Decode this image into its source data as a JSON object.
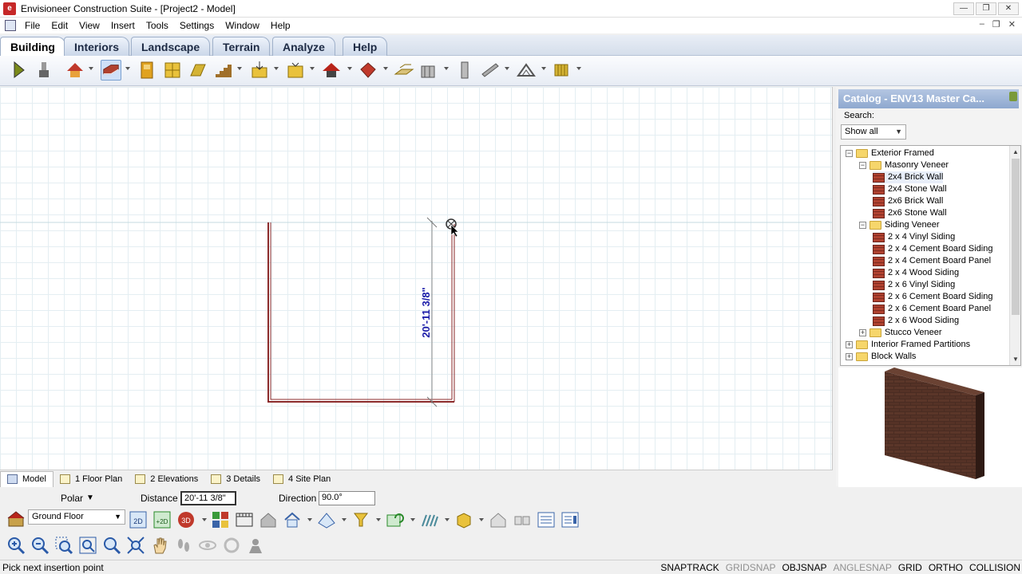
{
  "window": {
    "title": "Envisioneer Construction Suite - [Project2 - Model]",
    "app_icon_letter": "e"
  },
  "menu": [
    "File",
    "Edit",
    "View",
    "Insert",
    "Tools",
    "Settings",
    "Window",
    "Help"
  ],
  "ribbon_tabs": [
    "Building",
    "Interiors",
    "Landscape",
    "Terrain",
    "Analyze",
    "Help"
  ],
  "active_tab": "Building",
  "canvas": {
    "dimension_label": "20'-11 3/8\"",
    "wall_color": "#8b2a2a",
    "dimension_color": "#1a1aa8",
    "grid_color": "#e4eef2"
  },
  "catalog": {
    "header": "Catalog - ENV13 Master Ca...",
    "search_label": "Search:",
    "search_value": "Show all",
    "tree": [
      {
        "label": "Exterior Framed",
        "level": 0,
        "type": "folder",
        "exp": "-"
      },
      {
        "label": "Masonry Veneer",
        "level": 1,
        "type": "folder",
        "exp": "-"
      },
      {
        "label": "2x4  Brick Wall",
        "level": 2,
        "type": "wall",
        "selected": true
      },
      {
        "label": "2x4 Stone Wall",
        "level": 2,
        "type": "wall"
      },
      {
        "label": "2x6 Brick Wall",
        "level": 2,
        "type": "wall"
      },
      {
        "label": "2x6 Stone Wall",
        "level": 2,
        "type": "wall"
      },
      {
        "label": "Siding Veneer",
        "level": 1,
        "type": "folder",
        "exp": "-"
      },
      {
        "label": "2 x 4 Vinyl Siding",
        "level": 2,
        "type": "wall"
      },
      {
        "label": "2 x 4 Cement Board Siding",
        "level": 2,
        "type": "wall"
      },
      {
        "label": "2 x 4 Cement Board Panel",
        "level": 2,
        "type": "wall"
      },
      {
        "label": "2 x 4 Wood Siding",
        "level": 2,
        "type": "wall"
      },
      {
        "label": "2 x 6 Vinyl Siding",
        "level": 2,
        "type": "wall"
      },
      {
        "label": "2 x 6 Cement Board Siding",
        "level": 2,
        "type": "wall"
      },
      {
        "label": "2 x 6 Cement Board Panel",
        "level": 2,
        "type": "wall"
      },
      {
        "label": "2 x 6 Wood Siding",
        "level": 2,
        "type": "wall"
      },
      {
        "label": "Stucco Veneer",
        "level": 1,
        "type": "folder",
        "exp": "+"
      },
      {
        "label": "Interior Framed Partitions",
        "level": 0,
        "type": "folder",
        "exp": "+"
      },
      {
        "label": "Block Walls",
        "level": 0,
        "type": "folder",
        "exp": "+"
      }
    ]
  },
  "sheet_tabs": [
    {
      "label": "Model",
      "active": true
    },
    {
      "label": "1 Floor Plan"
    },
    {
      "label": "2 Elevations"
    },
    {
      "label": "3 Details"
    },
    {
      "label": "4 Site Plan"
    }
  ],
  "command": {
    "mode": "Polar",
    "distance_label": "Distance",
    "distance_value": "20'-11 3/8\"",
    "direction_label": "Direction",
    "direction_value": "90.0°"
  },
  "floor": {
    "value": "Ground Floor"
  },
  "status": {
    "text": "Pick next insertion point",
    "snaps": [
      {
        "label": "SNAPTRACK",
        "on": true
      },
      {
        "label": "GRIDSNAP",
        "on": false
      },
      {
        "label": "OBJSNAP",
        "on": true
      },
      {
        "label": "ANGLESNAP",
        "on": false
      },
      {
        "label": "GRID",
        "on": true
      },
      {
        "label": "ORTHO",
        "on": true
      },
      {
        "label": "COLLISION",
        "on": true
      }
    ]
  }
}
